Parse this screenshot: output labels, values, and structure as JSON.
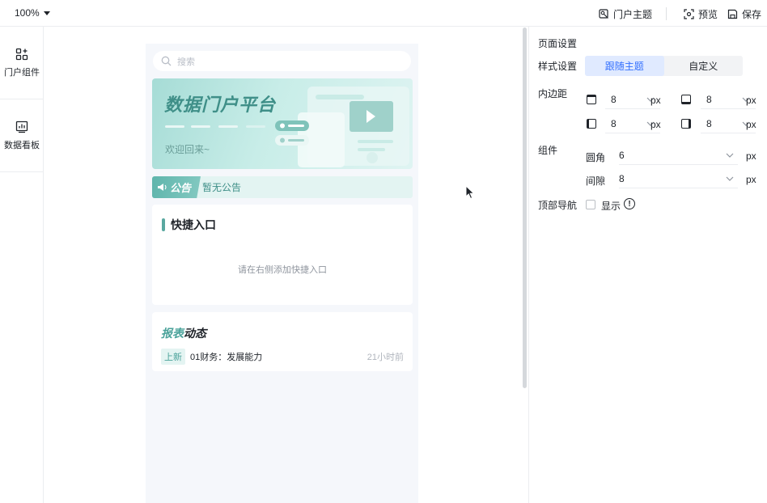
{
  "toolbar": {
    "zoom": "100%",
    "portal_theme": "门户主题",
    "preview": "预览",
    "save": "保存"
  },
  "rail": {
    "items": [
      {
        "label": "门户组件",
        "icon": "components-icon"
      },
      {
        "label": "数据看板",
        "icon": "dashboard-icon"
      }
    ]
  },
  "phone": {
    "search_placeholder": "搜索",
    "banner": {
      "title": "数据门户平台",
      "subtitle": "欢迎回来~"
    },
    "notice": {
      "tag": "公告",
      "text": "暂无公告"
    },
    "quick_entry": {
      "title": "快捷入口",
      "empty_hint": "请在右侧添加快捷入口"
    },
    "reports": {
      "title_a": "报表",
      "title_b": "动态",
      "items": [
        {
          "tag": "上新",
          "name": "01财务：发展能力",
          "time": "21小时前"
        }
      ]
    }
  },
  "panel": {
    "title": "页面设置",
    "style_label": "样式设置",
    "style_options": [
      "跟随主题",
      "自定义"
    ],
    "style_selected": "跟随主题",
    "padding_label": "内边距",
    "padding": {
      "top": "8",
      "bottom": "8",
      "left": "8",
      "right": "8"
    },
    "unit": "px",
    "component_label": "组件",
    "radius_label": "圆角",
    "radius_value": "6",
    "gap_label": "间隙",
    "gap_value": "8",
    "topnav_label": "顶部导航",
    "show_label": "显示",
    "info_glyph": "!"
  },
  "colors": {
    "accent_blue": "#3370ff",
    "brand_teal": "#4aa29a",
    "banner_start": "#a6dcd6"
  }
}
